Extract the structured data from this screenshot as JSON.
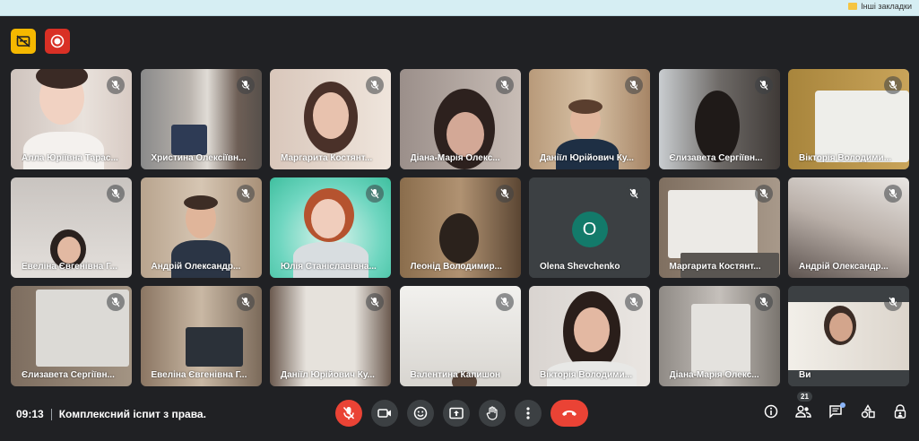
{
  "bookmarks": {
    "other_label": "Інші закладки"
  },
  "meeting": {
    "time": "09:13",
    "title": "Комплексний іспит з права."
  },
  "participants_count": "21",
  "tiles": [
    {
      "name": "Алла Юріївна Тарас..."
    },
    {
      "name": "Христина Олексіївн..."
    },
    {
      "name": "Маргарита Костянт..."
    },
    {
      "name": "Діана-Марія Олекс..."
    },
    {
      "name": "Даніїл Юрійович Ку..."
    },
    {
      "name": "Єлизавета Сергіївн..."
    },
    {
      "name": "Вікторія Володими..."
    },
    {
      "name": "Евеліна Євгенівна Г..."
    },
    {
      "name": "Андрій Олександр..."
    },
    {
      "name": "Юлія Станіславівна..."
    },
    {
      "name": "Леонід Володимир..."
    },
    {
      "name": "Olena Shevchenko",
      "initial": "O"
    },
    {
      "name": "Маргарита Костянт..."
    },
    {
      "name": "Андрій Олександр..."
    },
    {
      "name": "Єлизавета Сергіївн..."
    },
    {
      "name": "Евеліна Євгенівна Г..."
    },
    {
      "name": "Даніїл Юрійович Ку..."
    },
    {
      "name": "Валентина Капишон"
    },
    {
      "name": "Вікторія Володими..."
    },
    {
      "name": "Діана-Марія Олекс..."
    },
    {
      "name": "Ви"
    }
  ],
  "colors": {
    "background": "#202124",
    "end_call": "#ea4335",
    "avatar": "#137a6a"
  }
}
